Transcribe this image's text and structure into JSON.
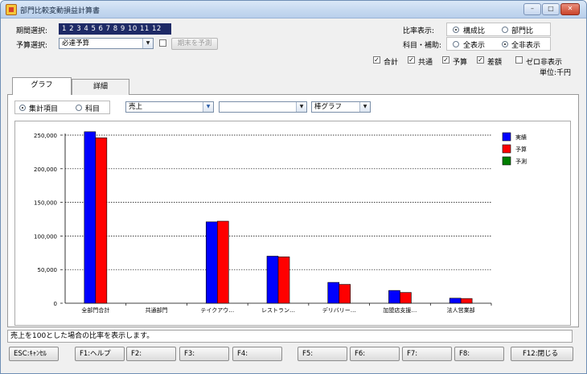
{
  "window": {
    "title": "部門比較変動損益計算書",
    "controls": [
      "–",
      "□",
      "✕"
    ]
  },
  "top": {
    "period_label": "期間選択:",
    "period_value": "1 2 3 4 5 6 7 8 9 10 11 12",
    "budget_label": "予算選択:",
    "budget_value": "必達予算",
    "year_end_predict": "期末を予測",
    "ratio_label": "比率表示:",
    "ratio_options": [
      "構成比",
      "部門比"
    ],
    "account_label": "科目・補助:",
    "account_options": [
      "全表示",
      "全非表示"
    ],
    "toggles": [
      "合計",
      "共通",
      "予算",
      "差額",
      "ゼロ非表示"
    ],
    "unit": "単位:千円"
  },
  "tabs": [
    "グラフ",
    "詳細"
  ],
  "filter": {
    "radio_options": [
      "集計項目",
      "科目"
    ],
    "item_value": "売上",
    "sub_value": "",
    "graph_type": "棒グラフ"
  },
  "chart_data": {
    "type": "bar",
    "categories": [
      "全部門合計",
      "共通部門",
      "テイクアウ…",
      "レストラン…",
      "デリバリー…",
      "加盟店支援…",
      "法人営業部"
    ],
    "series": [
      {
        "name": "実績",
        "color": "#0000ff",
        "values": [
          255000,
          0,
          121000,
          70000,
          31000,
          19000,
          7500
        ]
      },
      {
        "name": "予算",
        "color": "#ff0000",
        "values": [
          246000,
          0,
          122000,
          69000,
          28000,
          16000,
          7000
        ]
      },
      {
        "name": "予測",
        "color": "#007f00",
        "values": [
          0,
          0,
          0,
          0,
          0,
          0,
          0
        ]
      }
    ],
    "y_ticks": [
      "0",
      "50,000",
      "100,000",
      "150,000",
      "200,000",
      "250,000"
    ],
    "ylim": [
      0,
      250000
    ],
    "grid": true,
    "legend": "top-right"
  },
  "status_text": "売上を100とした場合の比率を表示します。",
  "fkeys": [
    "ESC:ｷｬﾝｾﾙ",
    "F1:ヘルプ",
    "F2:",
    "F3:",
    "F4:",
    "F5:",
    "F6:",
    "F7:",
    "F8:",
    "F12:閉じる"
  ]
}
